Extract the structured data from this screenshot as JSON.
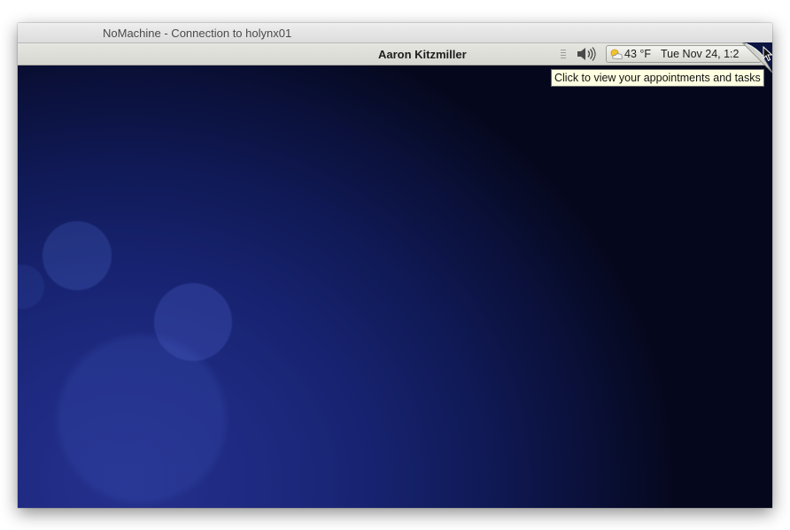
{
  "window": {
    "title": "NoMachine - Connection to holynx01"
  },
  "panel": {
    "user_name": "Aaron Kitzmiller",
    "volume_icon": "volume-icon",
    "weather_icon": "partly-cloudy-icon",
    "weather_temp": "43 °F",
    "clock": "Tue Nov 24,  1:2"
  },
  "tooltip": {
    "text": "Click to view your appointments and tasks"
  },
  "colors": {
    "desktop_bg": "#172370",
    "tooltip_bg": "#ffffe1",
    "panel_bg": "#e0e0db"
  }
}
